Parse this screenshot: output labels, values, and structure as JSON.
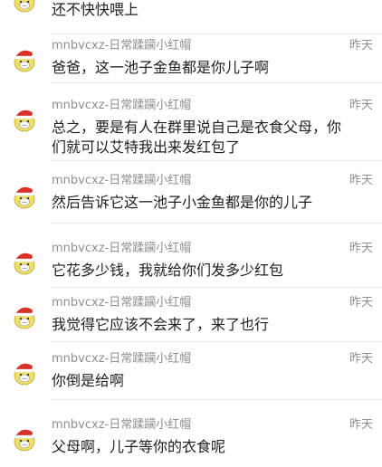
{
  "comments": [
    {
      "user": "",
      "time": "",
      "text": "还不快快喂上"
    },
    {
      "user": "mnbvcxz-日常蹂躏小红帽",
      "time": "昨天",
      "text": "爸爸，这一池子金鱼都是你儿子啊"
    },
    {
      "user": "mnbvcxz-日常蹂躏小红帽",
      "time": "昨天",
      "text": "总之，要是有人在群里说自己是衣食父母，你们就可以艾特我出来发红包了"
    },
    {
      "user": "mnbvcxz-日常蹂躏小红帽",
      "time": "昨天",
      "text": "然后告诉它这一池子小金鱼都是你的儿子"
    },
    {
      "user": "mnbvcxz-日常蹂躏小红帽",
      "time": "昨天",
      "text": "它花多少钱，我就给你们发多少红包"
    },
    {
      "user": "mnbvcxz-日常蹂躏小红帽",
      "time": "昨天",
      "text": "我觉得它应该不会来了，来了也行"
    },
    {
      "user": "mnbvcxz-日常蹂躏小红帽",
      "time": "昨天",
      "text": "你倒是给啊"
    },
    {
      "user": "mnbvcxz-日常蹂躏小红帽",
      "time": "昨天",
      "text": "父母啊，儿子等你的衣食呢"
    }
  ],
  "avatar_icon": "santa-hat-avatar-icon",
  "colors": {
    "meta_text": "#8f8f8f",
    "message_text": "#1e1e1e",
    "separator": "#e8e8e8",
    "hat_red": "#d8312a",
    "face_yellow": "#efdf63"
  }
}
